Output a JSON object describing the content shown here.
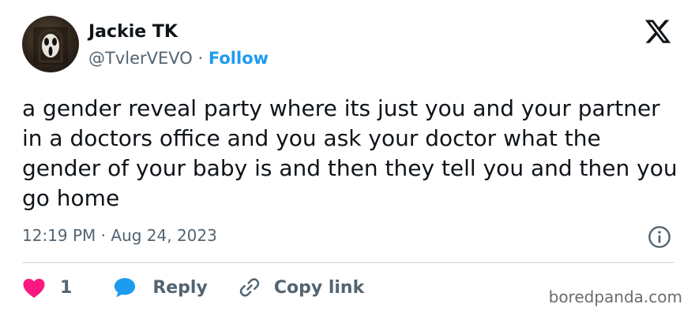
{
  "author": {
    "name": "Jackie TK",
    "handle": "@TvlerVEVO",
    "separator": "·",
    "follow_label": "Follow"
  },
  "tweet": {
    "text": "a gender reveal party where its just you and your partner in a doctors office and you ask your doctor what the gender of your baby is and then they tell you and then you go home",
    "timestamp": "12:19 PM · Aug 24, 2023"
  },
  "actions": {
    "like_count": "1",
    "reply_label": "Reply",
    "copy_link_label": "Copy link"
  },
  "watermark": "boredpanda.com",
  "icons": {
    "logo": "x-logo-icon",
    "info": "info-icon",
    "like": "heart-icon",
    "reply": "reply-bubble-icon",
    "copy": "link-icon"
  },
  "colors": {
    "follow": "#1d9bf0",
    "heart": "#f91880",
    "reply_bubble": "#1d9bf0",
    "secondary_text": "#536471"
  }
}
